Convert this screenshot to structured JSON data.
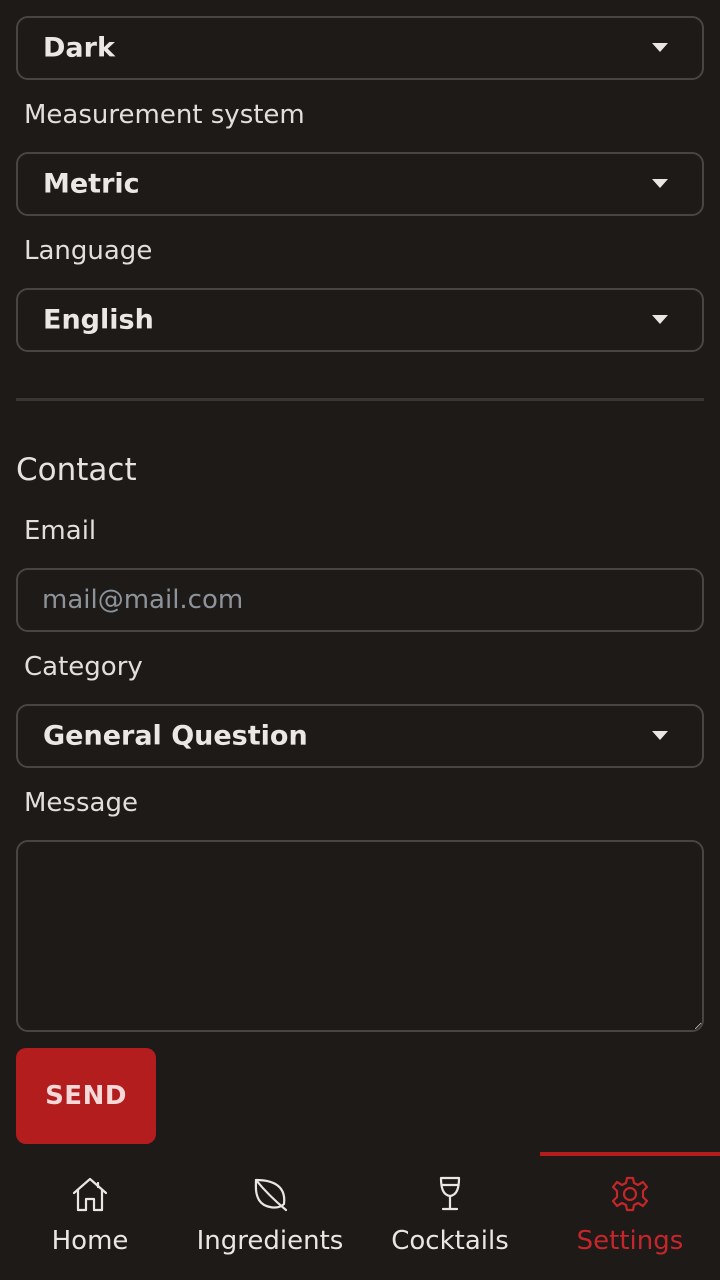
{
  "preferences": {
    "theme_value": "Dark",
    "measurement_label": "Measurement system",
    "measurement_value": "Metric",
    "language_label": "Language",
    "language_value": "English"
  },
  "contact": {
    "title": "Contact",
    "email_label": "Email",
    "email_placeholder": "mail@mail.com",
    "email_value": "",
    "category_label": "Category",
    "category_value": "General Question",
    "message_label": "Message",
    "message_value": "",
    "send_label": "SEND"
  },
  "nav": {
    "items": [
      {
        "label": "Home",
        "icon": "home-icon"
      },
      {
        "label": "Ingredients",
        "icon": "leaf-icon"
      },
      {
        "label": "Cocktails",
        "icon": "wine-glass-icon"
      },
      {
        "label": "Settings",
        "icon": "gear-icon",
        "active": true
      }
    ],
    "active_color": "#b31d1e"
  },
  "colors": {
    "background": "#1e1a18",
    "accent": "#b31d1e",
    "border": "#4a4542",
    "placeholder": "#8d939a"
  }
}
